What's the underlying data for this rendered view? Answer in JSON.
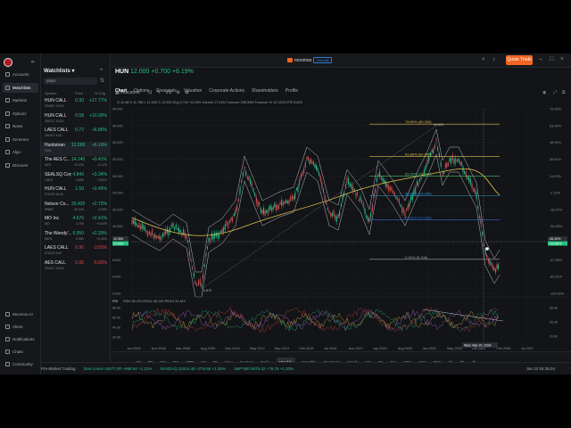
{
  "window": {
    "brand": "moomoo",
    "brand_tag": "Ultimate",
    "trade_button": "Quote Trade"
  },
  "leftnav": {
    "items": [
      {
        "label": "Accounts",
        "icon": "wallet-icon"
      },
      {
        "label": "Watchlists",
        "icon": "star-icon"
      },
      {
        "label": "Markets",
        "icon": "globe-icon"
      },
      {
        "label": "Options",
        "icon": "options-icon"
      },
      {
        "label": "News",
        "icon": "news-icon"
      },
      {
        "label": "Screener",
        "icon": "filter-icon"
      },
      {
        "label": "Algo",
        "icon": "algo-icon"
      },
      {
        "label": "Discover",
        "icon": "compass-icon"
      }
    ],
    "bottom_items": [
      {
        "label": "Moomoo AI",
        "icon": "ai-icon"
      },
      {
        "label": "Alerts",
        "icon": "bell-icon"
      },
      {
        "label": "Notifications",
        "icon": "notify-icon"
      },
      {
        "label": "Chats",
        "icon": "chat-icon"
      },
      {
        "label": "Community",
        "icon": "community-icon"
      }
    ]
  },
  "watchlist": {
    "title": "Watchlists",
    "search_value": "plays",
    "headers": {
      "symbol": "Symbol",
      "price": "Price",
      "chg": "% Chg"
    },
    "rows": [
      {
        "name": "HUN CALL",
        "sub": "250821 16.00",
        "price": "0.30",
        "price_sub": "",
        "chg": "+17.77%",
        "chg_sub": "",
        "dir": "up"
      },
      {
        "name": "HUN CALL",
        "sub": "250717 15.00",
        "price": "0.58",
        "price_sub": "",
        "chg": "+10.99%",
        "chg_sub": "",
        "dir": "up"
      },
      {
        "name": "LAES CALL",
        "sub": "250417 6.00",
        "price": "0.72",
        "price_sub": "",
        "chg": "+6.85%",
        "chg_sub": "",
        "dir": "up"
      },
      {
        "name": "Huntsman",
        "sub": "HUN",
        "price": "12.000",
        "price_sub": "",
        "chg": "+6.19%",
        "chg_sub": "",
        "dir": "up"
      },
      {
        "name": "The AES C...",
        "sub": "AES",
        "price": "14.240",
        "price_sub": "14.220",
        "chg": "+0.41%",
        "chg_sub": "-0.14%",
        "dir": "up"
      },
      {
        "name": "SEALSQ Corp",
        "sub": "LAES",
        "price": "4.840",
        "price_sub": "4.680",
        "chg": "+3.34%",
        "chg_sub": "-3.51%",
        "dir": "up"
      },
      {
        "name": "HUN CALL",
        "sub": "270115 16.00",
        "price": "1.50",
        "price_sub": "",
        "chg": "+3.45%",
        "chg_sub": "",
        "dir": "up"
      },
      {
        "name": "Nelson Co...",
        "sub": "NNBR",
        "price": "20.420",
        "price_sub": "20.420",
        "chg": "+2.72%",
        "chg_sub": "0.00%",
        "dir": "up"
      },
      {
        "name": "MO Inc",
        "sub": "MO",
        "price": "4.670",
        "price_sub": "4.700",
        "chg": "+2.41%",
        "chg_sub": "+0.64%",
        "dir": "up"
      },
      {
        "name": "The Wendy'...",
        "sub": "WEN",
        "price": "6.950",
        "price_sub": "6.980",
        "chg": "+2.20%",
        "chg_sub": "+0.43%",
        "dir": "up"
      },
      {
        "name": "LAES CALL",
        "sub": "270115 5.00",
        "price": "0.90",
        "price_sub": "",
        "chg": "-3.91%",
        "chg_sub": "",
        "dir": "dn"
      },
      {
        "name": "AES CALL",
        "sub": "260417 25.00",
        "price": "0.95",
        "price_sub": "",
        "chg": "-5.00%",
        "chg_sub": "",
        "dir": "dn"
      }
    ]
  },
  "quote": {
    "symbol": "HUN",
    "price_line": "12.000 +0.700 +6.19%"
  },
  "tabs": [
    "Chart",
    "Options",
    "Financials",
    "Valuation",
    "Corporate Actions",
    "Shareholders",
    "Profile"
  ],
  "toolbar": {
    "indicators": "Indicators"
  },
  "ohlc": "O 11.98   H 11.788   L 12.040   C 12.000   Chg 0.700   +6.19%   Volume 17.41M   Turnover 206.99M   Turnover % 10.122%   P/E 8.600",
  "chart_data": {
    "type": "candlestick",
    "y_ticks": [
      "44.000",
      "40.000",
      "36.000",
      "32.000",
      "28.000",
      "24.000",
      "20.000",
      "16.000",
      "12.000",
      "8.000",
      "4.000",
      "0.000"
    ],
    "pct_ticks": [
      "75.39%",
      "63.06%",
      "46.94%",
      "30.61%",
      "14.23%",
      "-2.12%",
      "-18.47%",
      "-34.83%",
      "-51.19%",
      "-67.55%",
      "-83.91%",
      "-100.00%"
    ],
    "x_ticks": [
      "Jun 2005",
      "Nov 2006",
      "Mar 2008",
      "Aug 2009",
      "Dec 2010",
      "May 2012",
      "Sep 2013",
      "Feb 2015",
      "Jul 2016",
      "Nov 2017",
      "Apr 2019",
      "Aug 2020",
      "Jan 2022",
      "May 2023",
      "Oct 2024",
      "Feb 2026",
      "Jul 2027"
    ],
    "fib_levels": [
      {
        "label": "78.60% (40.343)",
        "value": 40.343,
        "color": "#e0c14d"
      },
      {
        "label": "61.80% (32.647)",
        "value": 32.647,
        "color": "#e0c14d"
      },
      {
        "label": "50.00% (28.000)",
        "value": 28.0,
        "color": "#4fbf6d"
      },
      {
        "label": "38.20% (23.249)",
        "value": 23.249,
        "color": "#2e9cd6"
      },
      {
        "label": "23.60% (17.492)",
        "value": 17.492,
        "color": "#2e6ed6"
      },
      {
        "label": "0.00% (8.108)",
        "value": 8.108,
        "color": "#9aa0a7"
      }
    ],
    "annotations": [
      "43.820",
      "0.870"
    ],
    "last_price": "12.000",
    "last_pct": "-45.40%",
    "hover_price": "12.394",
    "hover_pct": "+23.80%",
    "hover_date": "Wed, Mar 20, 2024",
    "ylim": [
      0,
      44
    ],
    "rsi": {
      "label": "RSI",
      "values_text": "RSI6 38.203   RSI12 48.149   RSI24 33.443",
      "ticks": [
        "80.00",
        "60.00",
        "40.00",
        "20.00"
      ],
      "right_ticks": [
        "80.00",
        "50.00",
        "20.00"
      ]
    }
  },
  "periods": [
    "1D",
    "5D",
    "1M",
    "3M",
    "YTD",
    "1Y",
    "3Y",
    "Max",
    "Custom",
    "Daily",
    "Weekly",
    "Monthly",
    "Quarterly",
    "Yearly",
    "1m",
    "3m",
    "5m",
    "10m",
    "15m",
    "30m",
    "1h",
    "2h",
    "4h"
  ],
  "active_period": "Weekly",
  "status": {
    "pre_market": "Pre-Market Trading",
    "dow": "Dow Jones 44677.00 +998.64 +1.21%",
    "nasdaq": "NASDAQ 22214.46 +276.56 +1.26%",
    "sp": "S&P 500 5975.42 +78.76 +1.33%",
    "time": "Jan 22 04:36:04"
  }
}
